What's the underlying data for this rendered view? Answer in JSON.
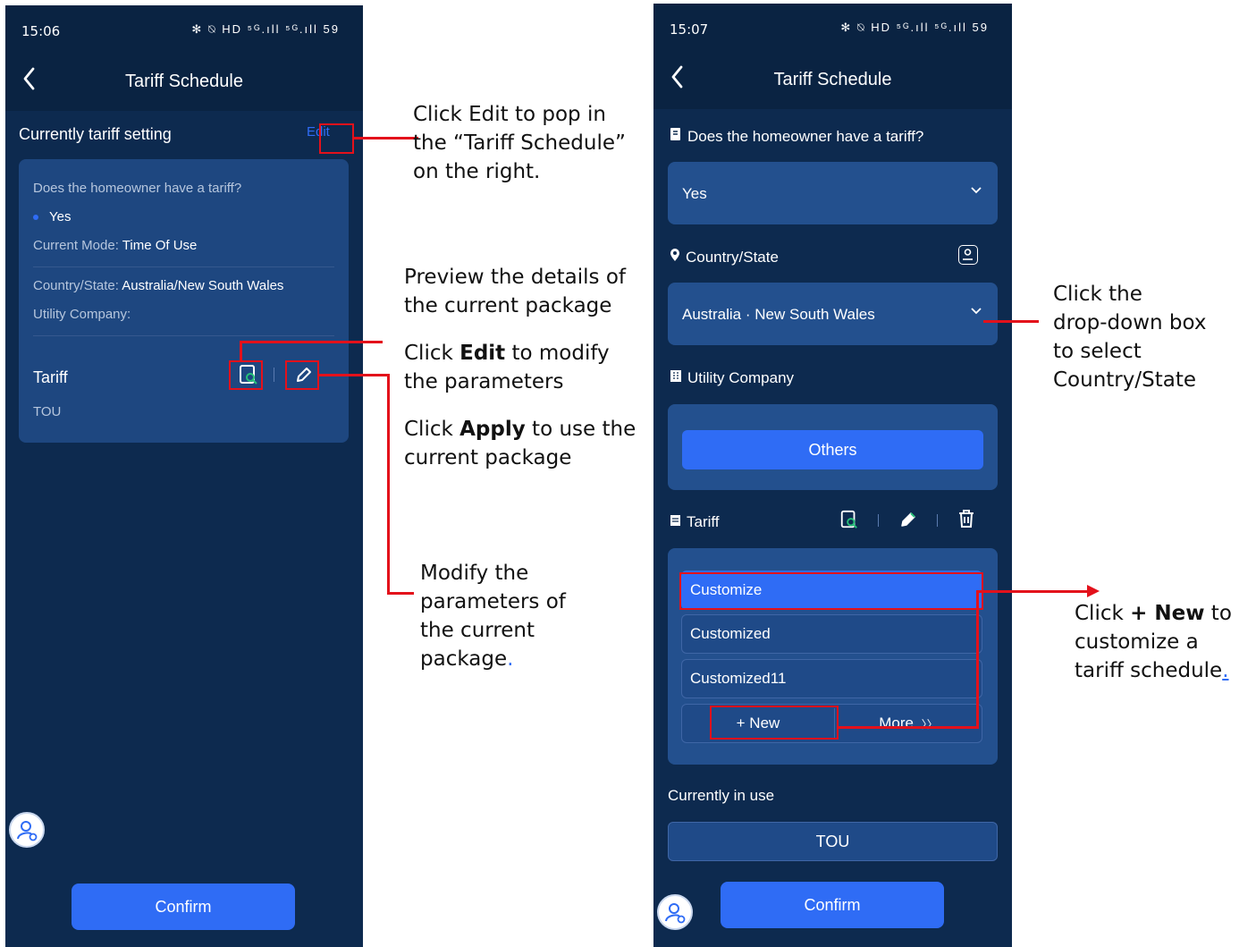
{
  "left_screen": {
    "status_time": "15:06",
    "status_icons": "✻ ⍉ HD ⁵ᴳ.ıll ⁵ᴳ.ıll 59",
    "title": "Tariff Schedule",
    "section_title": "Currently tariff setting",
    "edit_link": "Edit",
    "question": "Does the homeowner have a tariff?",
    "answer": "Yes",
    "current_mode_label": "Current Mode:",
    "current_mode_value": "Time Of Use",
    "country_label": "Country/State:",
    "country_value": "Australia/New South Wales",
    "utility_label": "Utility Company:",
    "tariff_label": "Tariff",
    "tariff_value": "TOU",
    "confirm": "Confirm"
  },
  "right_screen": {
    "status_time": "15:07",
    "status_icons": "✻ ⍉ HD ⁵ᴳ.ıll ⁵ᴳ.ıll 59",
    "title": "Tariff Schedule",
    "question": "Does the homeowner have a tariff?",
    "answer": "Yes",
    "country_label": "Country/State",
    "country_value": "Australia · New South Wales",
    "utility_label": "Utility Company",
    "utility_value": "Others",
    "tariff_label": "Tariff",
    "tariff_items": [
      "Customize",
      "Customized",
      "Customized11"
    ],
    "new_button": "+ New",
    "more_button": "More",
    "current_label": "Currently in use",
    "current_value": "TOU",
    "confirm": "Confirm"
  },
  "annotations": {
    "edit_popup_1": "Click Edit to pop in",
    "edit_popup_2": "the “Tariff Schedule”",
    "edit_popup_3": "on the right.",
    "preview_1": "Preview the details of",
    "preview_2": "the current package",
    "edit_params_pre": "Click ",
    "edit_params_bold": "Edit",
    "edit_params_post": " to modify",
    "edit_params_2": "the parameters",
    "apply_pre": "Click ",
    "apply_bold": "Apply",
    "apply_post": " to use the",
    "apply_2": "current package",
    "modify_1": "Modify the",
    "modify_2": "parameters of",
    "modify_3": "the current",
    "modify_4": "package",
    "modify_dot": ".",
    "dropdown_1": "Click the",
    "dropdown_2": "drop-down box",
    "dropdown_3": "to select",
    "dropdown_4": "Country/State",
    "new_pre": "Click ",
    "new_bold": "+ New",
    "new_post": " to",
    "new_2": "customize a",
    "new_3": "tariff schedule",
    "new_dot": "."
  },
  "colors": {
    "background": "#0d2a4f",
    "card": "#1e4780",
    "primary_button": "#2f6cf5",
    "annotation_red": "#e3111b"
  }
}
